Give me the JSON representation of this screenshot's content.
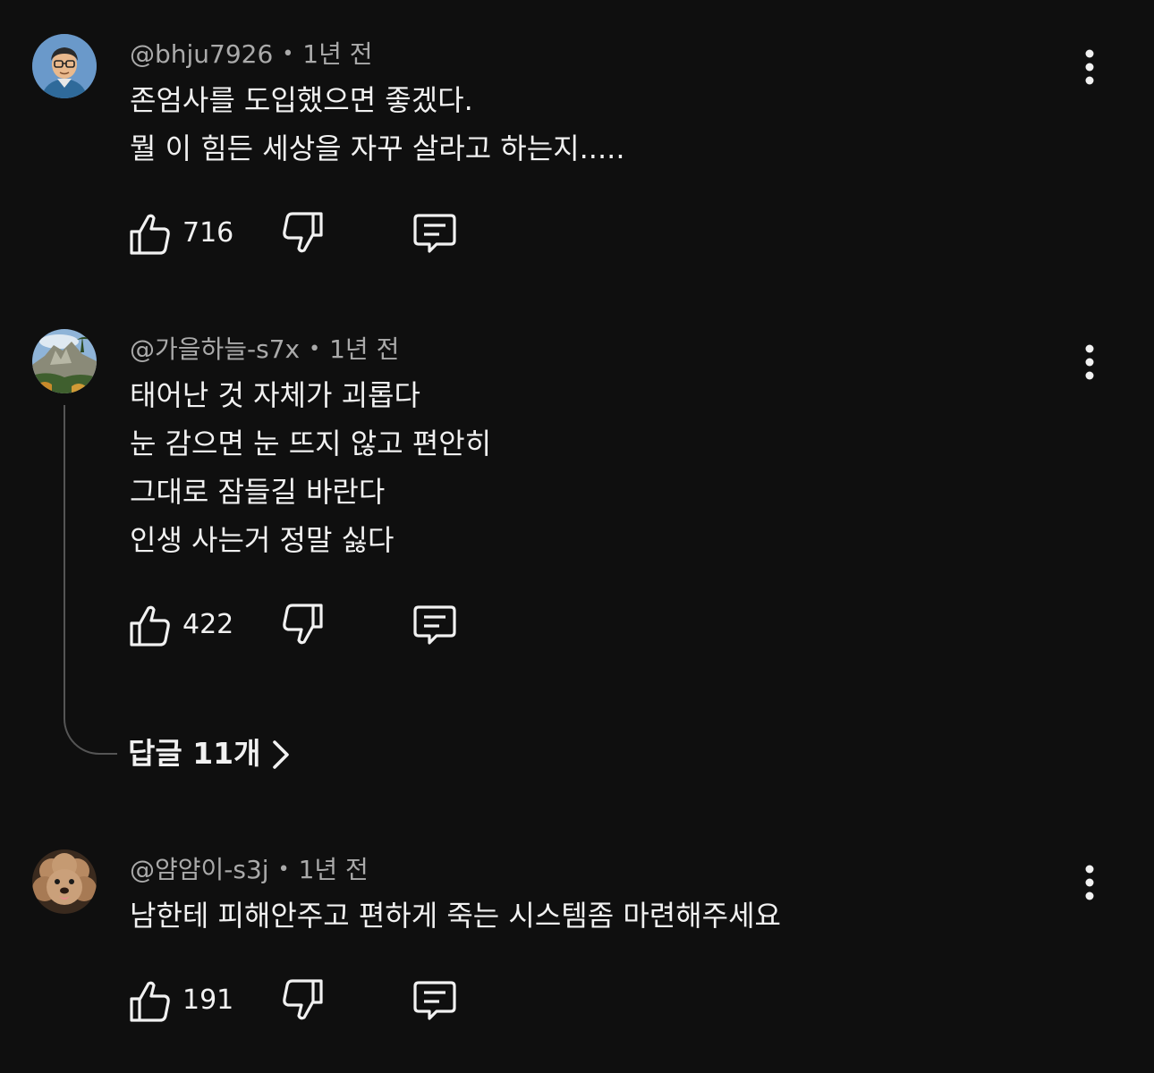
{
  "comments": [
    {
      "handle": "@bhju7926",
      "time": "1년 전",
      "lines": [
        "존엄사를 도입했으면 좋겠다.",
        "뭘 이 힘든 세상을 자꾸 살라고 하는지....."
      ],
      "likes": "716",
      "avatar_icon": "cartoon-man-with-glasses-avatar"
    },
    {
      "handle": "@가을하늘-s7x",
      "time": "1년 전",
      "lines": [
        "태어난 것 자체가 괴롭다",
        "눈 감으면 눈 뜨지 않고 편안히",
        "그대로 잠들길 바란다",
        "인생 사는거 정말 싫다"
      ],
      "likes": "422",
      "replies_label": "답글 11개",
      "avatar_icon": "mountain-landscape-avatar"
    },
    {
      "handle": "@얌얌이-s3j",
      "time": "1년 전",
      "lines": [
        "남한테 피해안주고 편하게 죽는 시스템좀 마련해주세요"
      ],
      "likes": "191",
      "avatar_icon": "poodle-dog-avatar"
    }
  ],
  "separator": "•",
  "colors": {
    "background": "#0f0f0f",
    "text_primary": "#f1f1f1",
    "text_secondary": "#aaaaaa",
    "thread_line": "#555555"
  }
}
